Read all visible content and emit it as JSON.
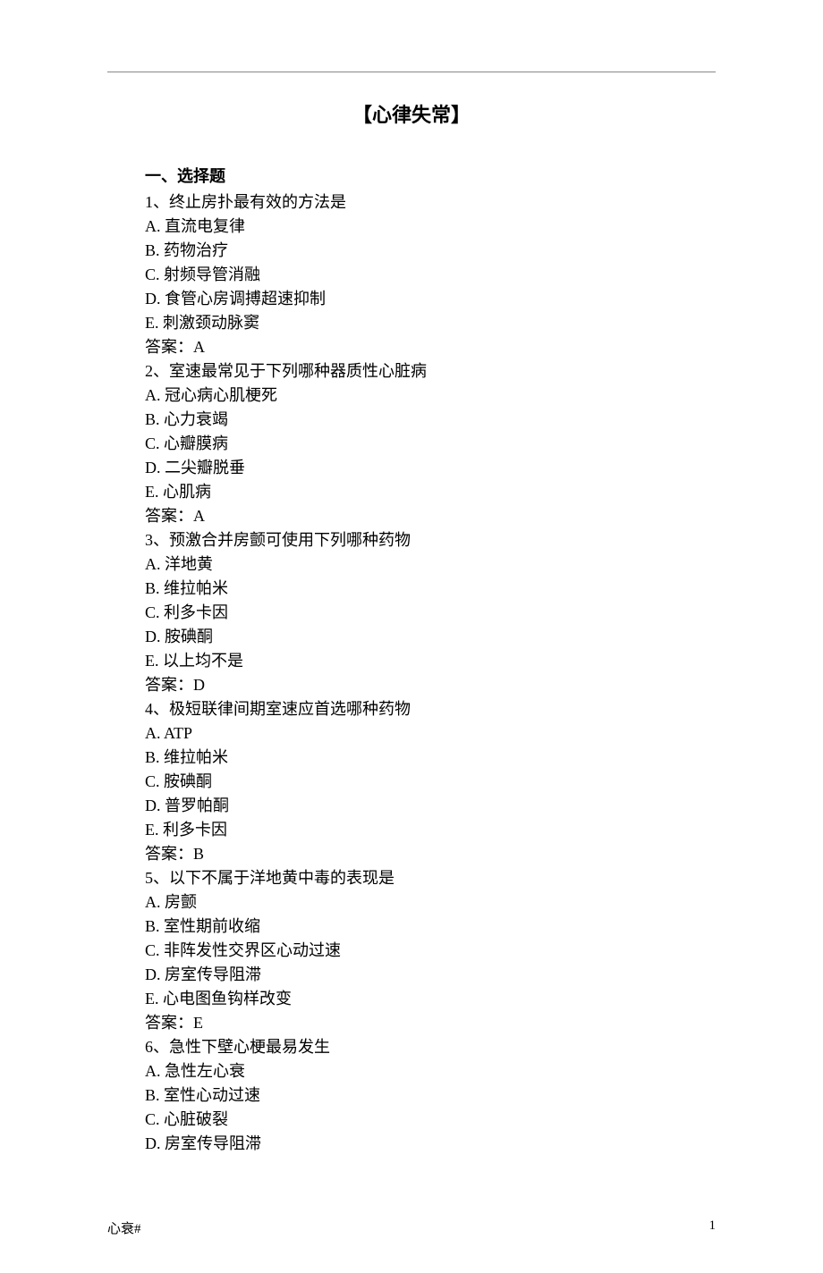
{
  "title": "【心律失常】",
  "section_heading": "一、选择题",
  "questions": [
    {
      "stem": "1、终止房扑最有效的方法是",
      "options": [
        "A.  直流电复律",
        "B.  药物治疗",
        "C.  射频导管消融",
        "D.  食管心房调搏超速抑制",
        "E.  刺激颈动脉窦"
      ],
      "answer": "答案：A"
    },
    {
      "stem": "2、室速最常见于下列哪种器质性心脏病",
      "options": [
        "A.  冠心病心肌梗死",
        "B.  心力衰竭",
        "C.  心瓣膜病",
        "D.  二尖瓣脱垂",
        "E.  心肌病"
      ],
      "answer": "答案：A"
    },
    {
      "stem": "3、预激合并房颤可使用下列哪种药物",
      "options": [
        "A.  洋地黄",
        "B.  维拉帕米",
        "C.  利多卡因",
        "D.  胺碘酮",
        "E.  以上均不是"
      ],
      "answer": "答案：D"
    },
    {
      "stem": "4、极短联律间期室速应首选哪种药物",
      "options": [
        "A.  ATP",
        "B.  维拉帕米",
        "C.  胺碘酮",
        "D.  普罗帕酮",
        "E.  利多卡因"
      ],
      "answer": "答案：B"
    },
    {
      "stem": "5、以下不属于洋地黄中毒的表现是",
      "options": [
        "A.  房颤",
        "B.  室性期前收缩",
        "C.  非阵发性交界区心动过速",
        "D.  房室传导阻滞",
        "E.  心电图鱼钩样改变"
      ],
      "answer": "答案：E"
    },
    {
      "stem": "6、急性下壁心梗最易发生",
      "options": [
        "A.  急性左心衰",
        "B.  室性心动过速",
        "C.  心脏破裂",
        "D.  房室传导阻滞"
      ],
      "answer": ""
    }
  ],
  "footer_left": "心衰#",
  "footer_right": "1"
}
